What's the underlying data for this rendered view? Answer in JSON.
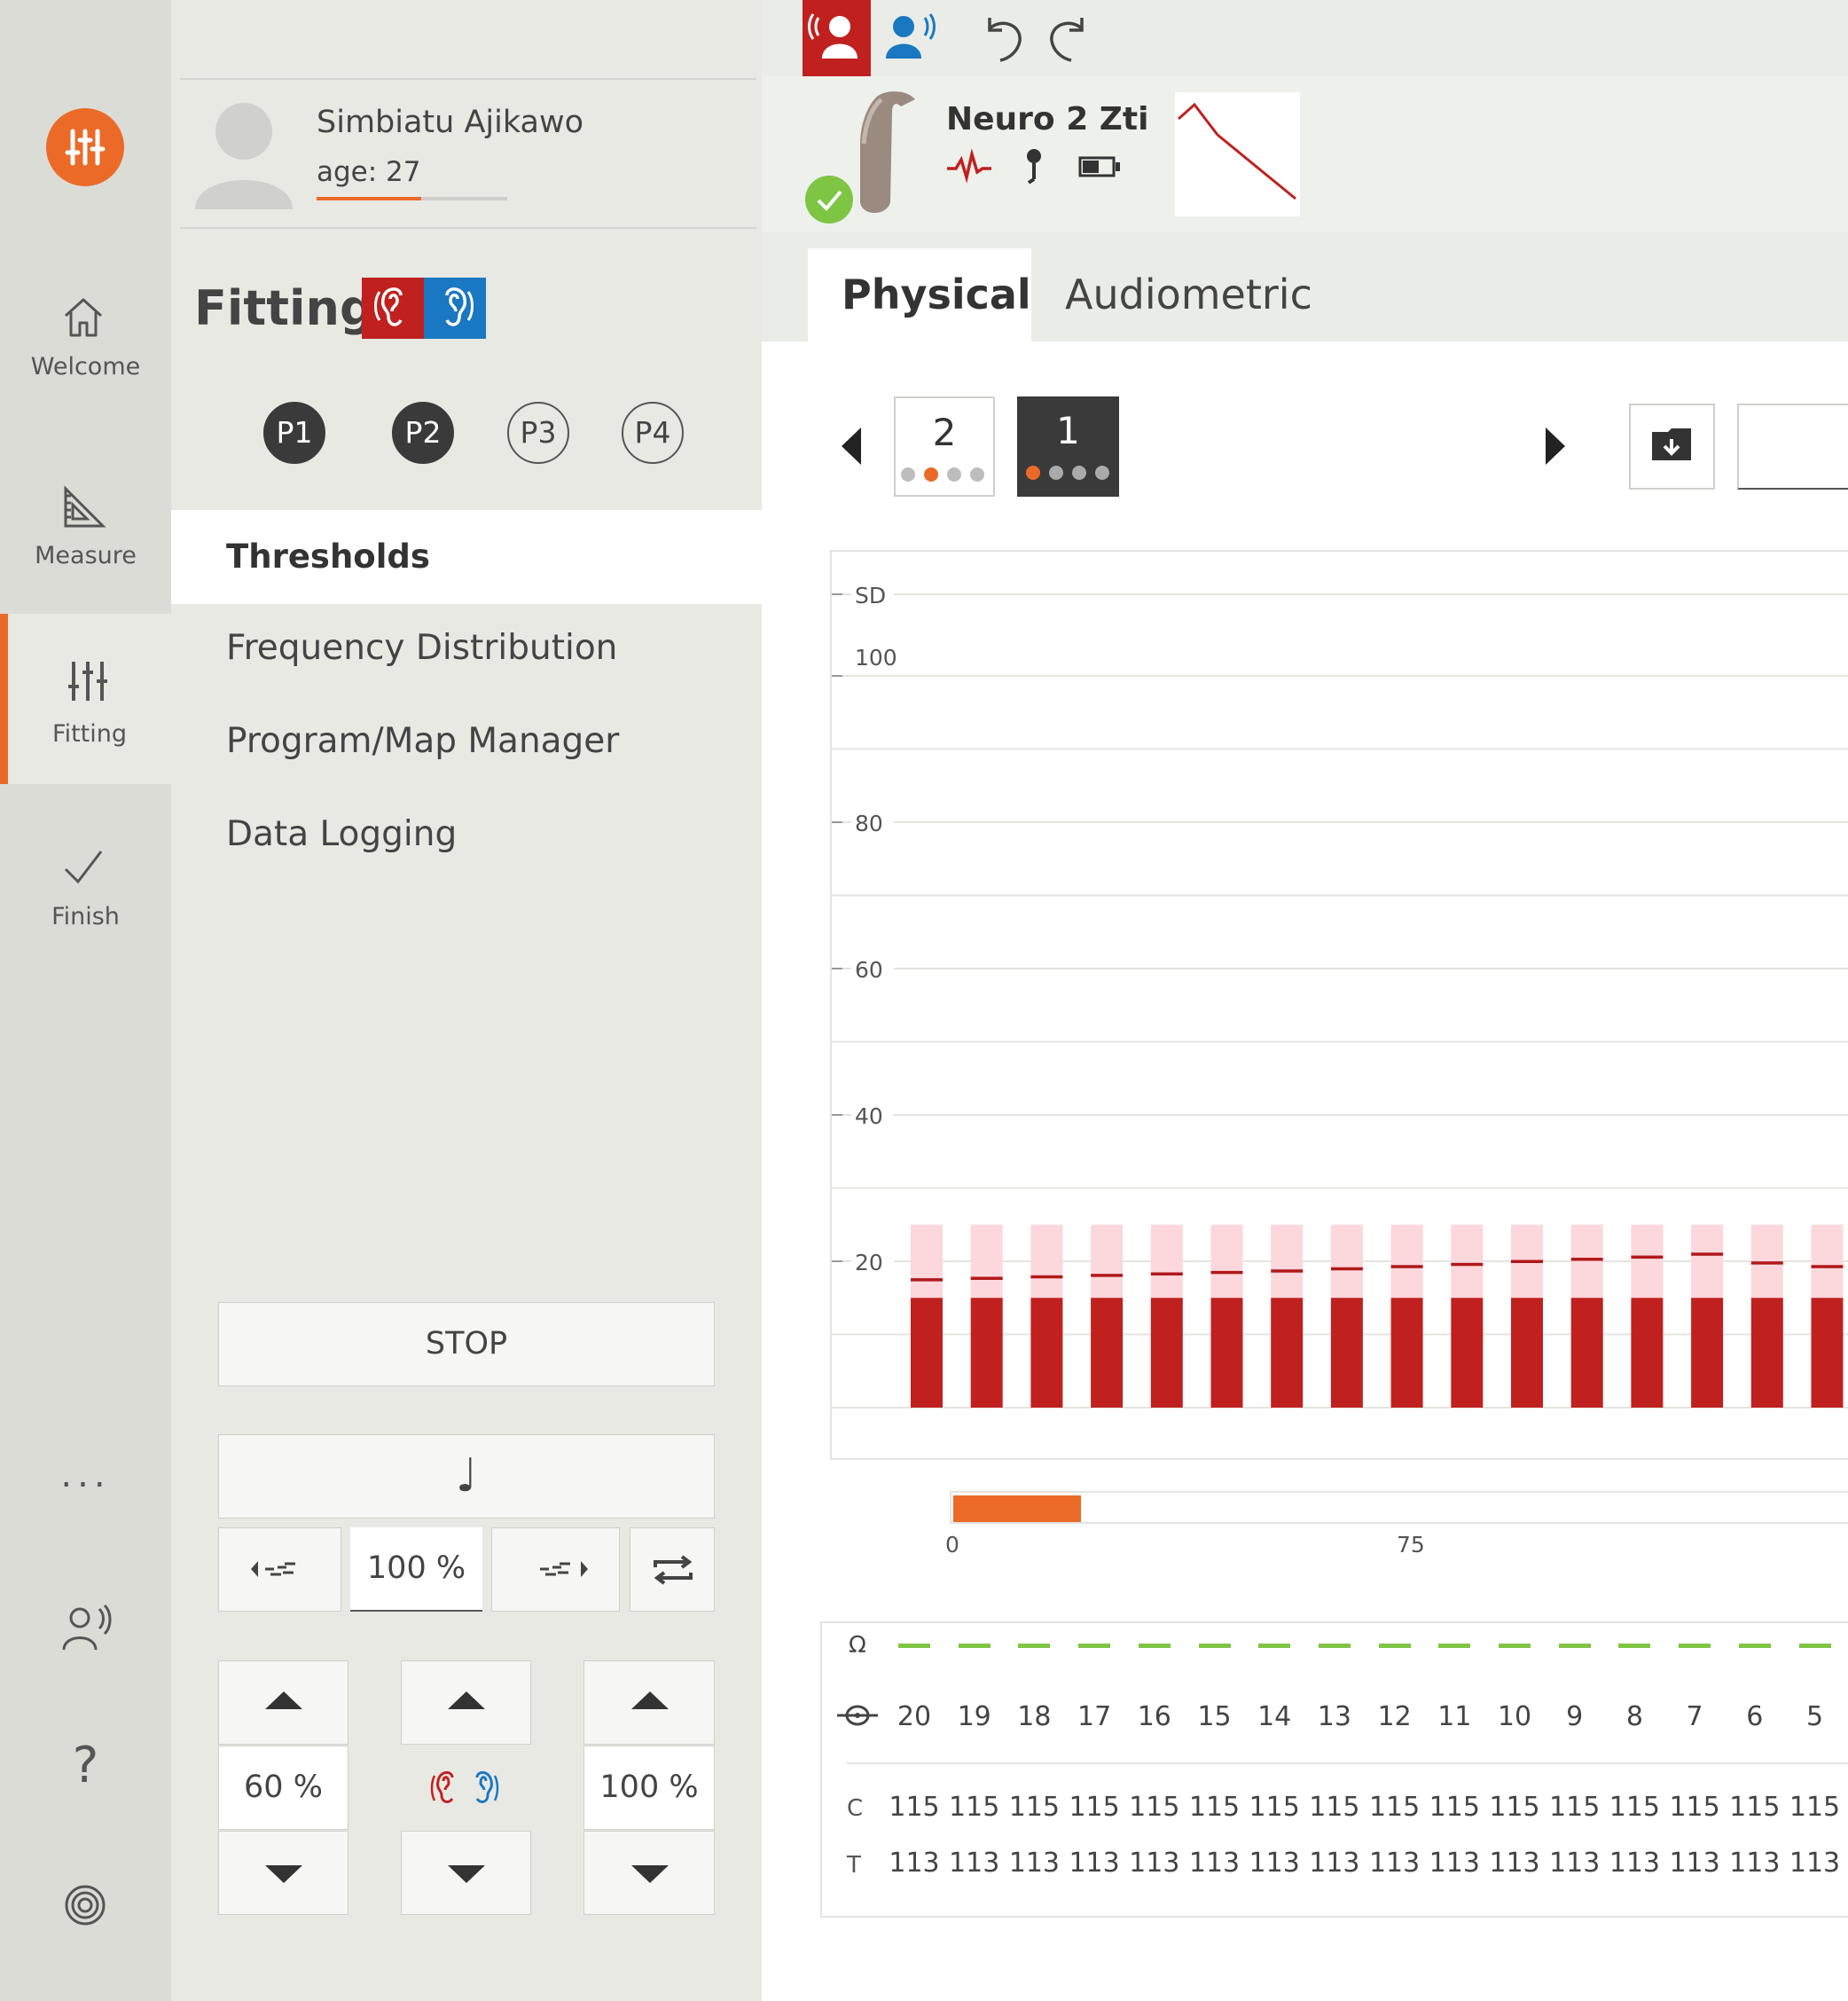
{
  "nav": {
    "items": [
      {
        "label": "Welcome",
        "icon": "home-icon"
      },
      {
        "label": "Measure",
        "icon": "ruler-icon"
      },
      {
        "label": "Fitting",
        "icon": "sliders-icon",
        "active": true
      },
      {
        "label": "Finish",
        "icon": "check-icon"
      }
    ],
    "more": "...",
    "help": "?"
  },
  "patient": {
    "name": "Simbiatu Ajikawo",
    "age": "age: 27"
  },
  "fitting": {
    "title": "Fitting",
    "programs": [
      {
        "label": "P1",
        "active": true
      },
      {
        "label": "P2",
        "active": true
      },
      {
        "label": "P3",
        "active": false
      },
      {
        "label": "P4",
        "active": false
      }
    ],
    "menu": [
      "Thresholds",
      "Frequency Distribution",
      "Program/Map Manager",
      "Data Logging"
    ]
  },
  "controls": {
    "stop": "STOP",
    "note": "♩",
    "speed": "100 %",
    "left_level": "60 %",
    "right_level": "100 %"
  },
  "device": {
    "name": "Neuro 2 Zti"
  },
  "tabs": {
    "physical": "Physical",
    "audiometric": "Audiometric"
  },
  "maps": [
    {
      "label": "2",
      "active": false,
      "dots": 4,
      "selected_dot": 1
    },
    {
      "label": "1",
      "active": true,
      "dots": 4,
      "selected_dot": 0
    }
  ],
  "colors": {
    "accent": "#ec6a28",
    "red": "#c0211f",
    "blue": "#1a78c2",
    "green": "#7ec544",
    "pink": "#fcd7dc"
  },
  "chart_data": {
    "type": "bar",
    "y_tick_labels": [
      "SD",
      "100",
      "80",
      "60",
      "40",
      "20"
    ],
    "ylim": [
      0,
      110
    ],
    "categories": [
      "20",
      "19",
      "18",
      "17",
      "16",
      "15",
      "14",
      "13",
      "12",
      "11",
      "10",
      "9",
      "8",
      "7",
      "6",
      "5"
    ],
    "series": [
      {
        "values": [
          15,
          15,
          15,
          15,
          15,
          15,
          15,
          15,
          15,
          15,
          15,
          15,
          15,
          15,
          15,
          15
        ]
      },
      {
        "values": [
          25,
          25,
          25,
          25,
          25,
          25,
          25,
          25,
          25,
          25,
          25,
          25,
          25,
          25,
          25,
          25
        ]
      },
      {
        "values": [
          17.5,
          17.7,
          17.9,
          18.1,
          18.3,
          18.5,
          18.7,
          19.0,
          19.3,
          19.6,
          20.0,
          20.3,
          20.6,
          21.0,
          19.8,
          19.3
        ]
      }
    ],
    "slider": {
      "labels": [
        "0",
        "75"
      ],
      "value_fraction": 0.08
    }
  },
  "electrodes": {
    "numbers": [
      "20",
      "19",
      "18",
      "17",
      "16",
      "15",
      "14",
      "13",
      "12",
      "11",
      "10",
      "9",
      "8",
      "7",
      "6",
      "5"
    ],
    "c_label": "C",
    "t_label": "T",
    "omega": "Ω",
    "c_values": [
      "115",
      "115",
      "115",
      "115",
      "115",
      "115",
      "115",
      "115",
      "115",
      "115",
      "115",
      "115",
      "115",
      "115",
      "115",
      "115"
    ],
    "t_values": [
      "113",
      "113",
      "113",
      "113",
      "113",
      "113",
      "113",
      "113",
      "113",
      "113",
      "113",
      "113",
      "113",
      "113",
      "113",
      "113"
    ]
  }
}
